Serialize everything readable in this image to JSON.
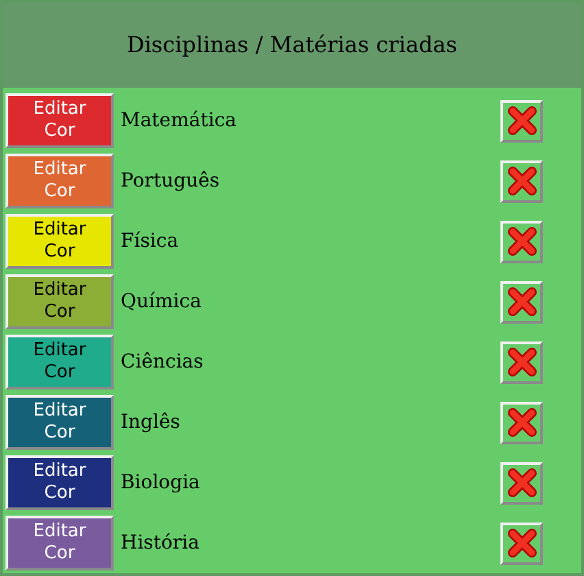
{
  "title": "Disciplinas / Matérias criadas",
  "subjects": [
    {
      "name": "Matemática",
      "button": "Editar Cor",
      "color": "#dc2a2e",
      "dark_text": false
    },
    {
      "name": "Português",
      "button": "Editar Cor",
      "color": "#de6633",
      "dark_text": false
    },
    {
      "name": "Física",
      "button": "Editar Cor",
      "color": "#e6e600",
      "dark_text": true
    },
    {
      "name": "Química",
      "button": "Editar Cor",
      "color": "#8cad36",
      "dark_text": true
    },
    {
      "name": "Ciências",
      "button": "Editar Cor",
      "color": "#1fab8c",
      "dark_text": true
    },
    {
      "name": "Inglês",
      "button": "Editar Cor",
      "color": "#156178",
      "dark_text": false
    },
    {
      "name": "Biologia",
      "button": "Editar Cor",
      "color": "#1e2f80",
      "dark_text": false
    },
    {
      "name": "História",
      "button": "Editar Cor",
      "color": "#7a5c9e",
      "dark_text": false
    }
  ]
}
